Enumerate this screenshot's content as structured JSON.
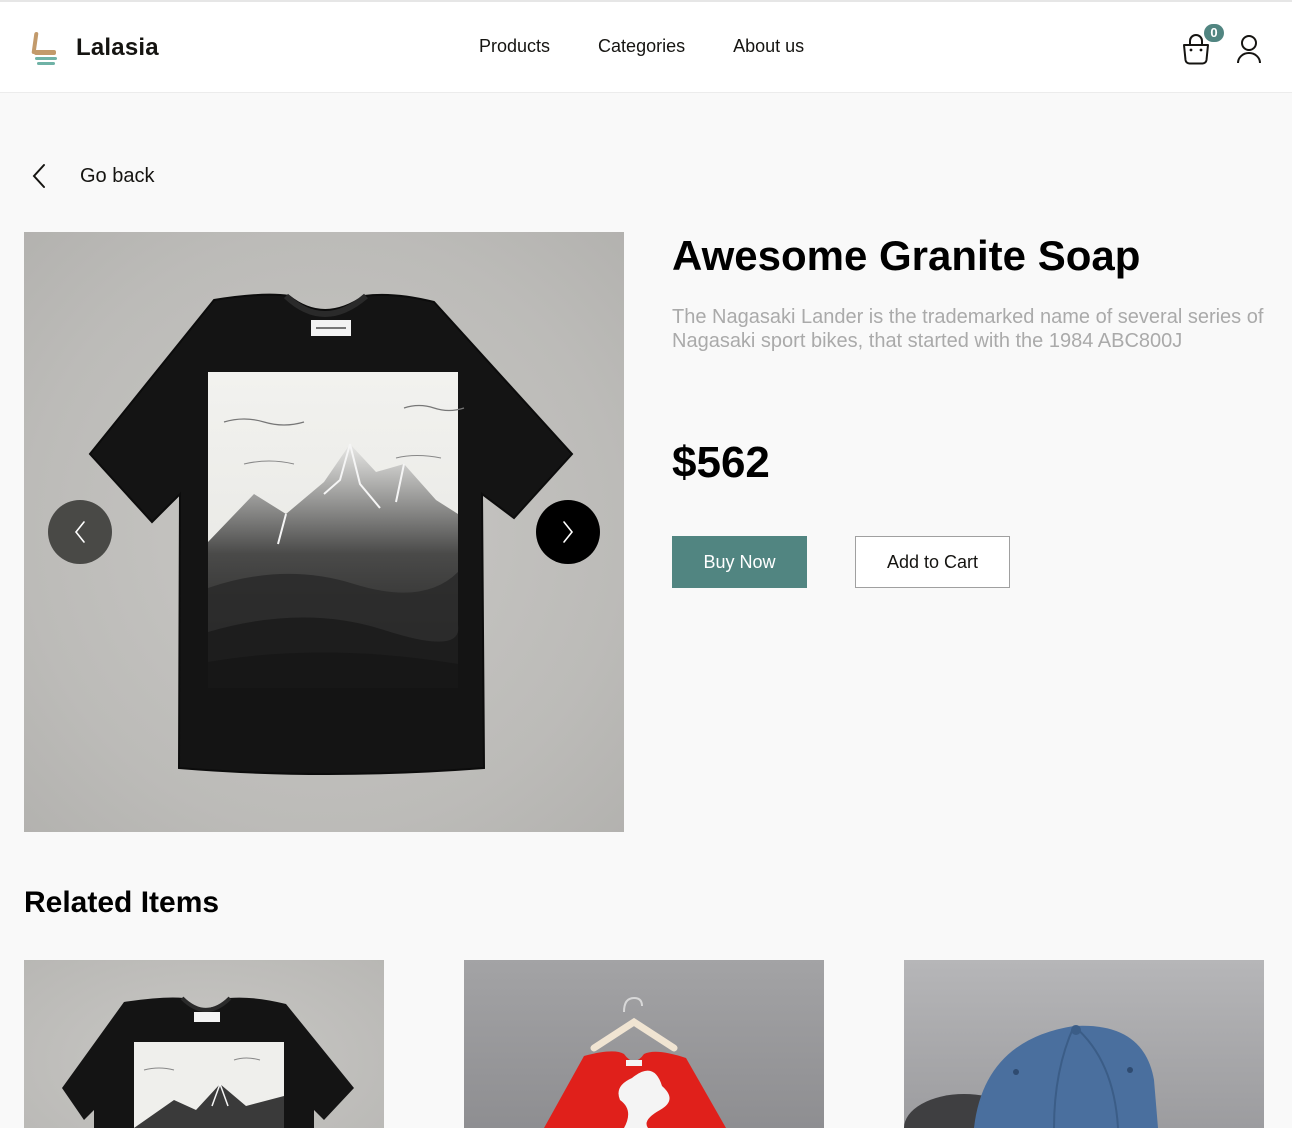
{
  "brand": {
    "name": "Lalasia"
  },
  "nav": {
    "items": [
      "Products",
      "Categories",
      "About us"
    ]
  },
  "cart": {
    "count": "0"
  },
  "back": {
    "label": "Go back"
  },
  "product": {
    "title": "Awesome Granite Soap",
    "description": "The Nagasaki Lander is the trademarked name of several series of Nagasaki sport bikes, that started with the 1984 ABC800J",
    "price": "$562",
    "buy_label": "Buy Now",
    "add_label": "Add to Cart"
  },
  "related": {
    "title": "Related Items"
  },
  "colors": {
    "accent": "#518581",
    "text": "#151411",
    "muted": "#aaaaaa",
    "background": "#f9f9f9"
  },
  "icons": [
    "logo-icon",
    "cart-icon",
    "user-icon",
    "chevron-left-icon",
    "chevron-right-icon"
  ]
}
